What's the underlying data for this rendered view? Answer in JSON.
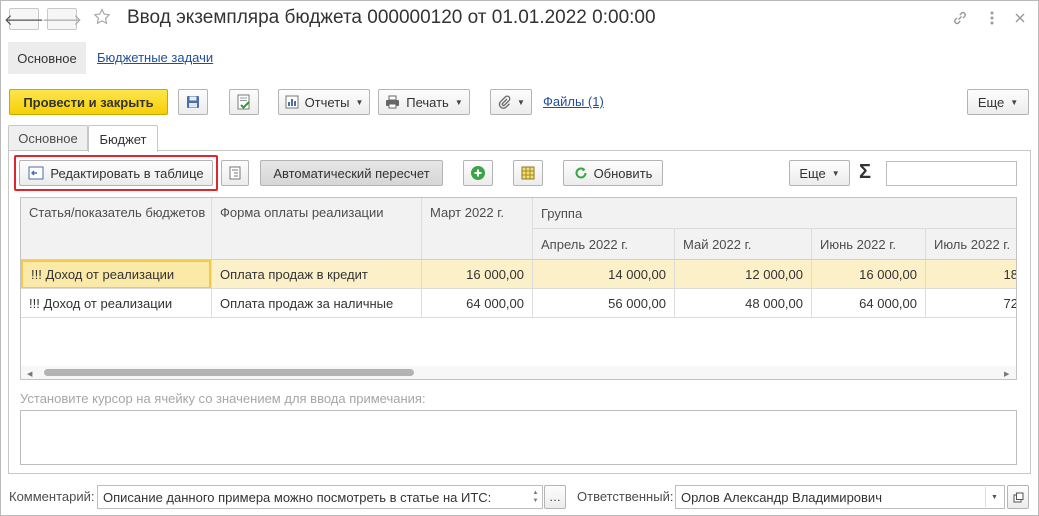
{
  "window": {
    "title": "Ввод экземпляра бюджета 000000120 от 01.01.2022 0:00:00"
  },
  "nav": {
    "back_glyph": "🡐",
    "forward_glyph": "🡒"
  },
  "sections": {
    "main_label": "Основное",
    "tasks_link": "Бюджетные задачи"
  },
  "toolbar": {
    "post_close_label": "Провести и закрыть",
    "reports_label": "Отчеты",
    "print_label": "Печать",
    "files_link": "Файлы (1)",
    "more_label": "Еще"
  },
  "tabs": [
    {
      "label": "Основное",
      "active": false
    },
    {
      "label": "Бюджет",
      "active": true
    }
  ],
  "budget_toolbar": {
    "edit_table_label": "Редактировать в таблице",
    "auto_recalc_label": "Автоматический пересчет",
    "refresh_label": "Обновить",
    "more_label": "Еще",
    "sum_glyph": "Σ",
    "search_value": ""
  },
  "table": {
    "headers": {
      "article": "Статья/показатель бюджетов",
      "payment_form": "Форма оплаты реализации",
      "march": "Март 2022 г.",
      "group": "Группа",
      "april": "Апрель 2022 г.",
      "may": "Май 2022 г.",
      "june": "Июнь 2022 г.",
      "july": "Июль 2022 г."
    },
    "rows": [
      {
        "article": "!!! Доход от реализации",
        "payment_form": "Оплата продаж в кредит",
        "march": "16 000,00",
        "april": "14 000,00",
        "may": "12 000,00",
        "june": "16 000,00",
        "july": "18"
      },
      {
        "article": "!!! Доход от реализации",
        "payment_form": "Оплата продаж за наличные",
        "march": "64 000,00",
        "april": "56 000,00",
        "may": "48 000,00",
        "june": "64 000,00",
        "july": "72"
      }
    ]
  },
  "note": {
    "hint": "Установите курсор на ячейку со значением для ввода примечания:",
    "value": ""
  },
  "footer": {
    "comment_label": "Комментарий:",
    "comment_value": "Описание данного примера можно посмотреть в статье на ИТС:",
    "responsible_label": "Ответственный:",
    "responsible_value": "Орлов Александр Владимирович"
  },
  "colors": {
    "accent_yellow": "#f8d51b",
    "selected_row": "#fbf0c8",
    "highlight_border": "#e0262c",
    "link": "#1d4f9c"
  }
}
